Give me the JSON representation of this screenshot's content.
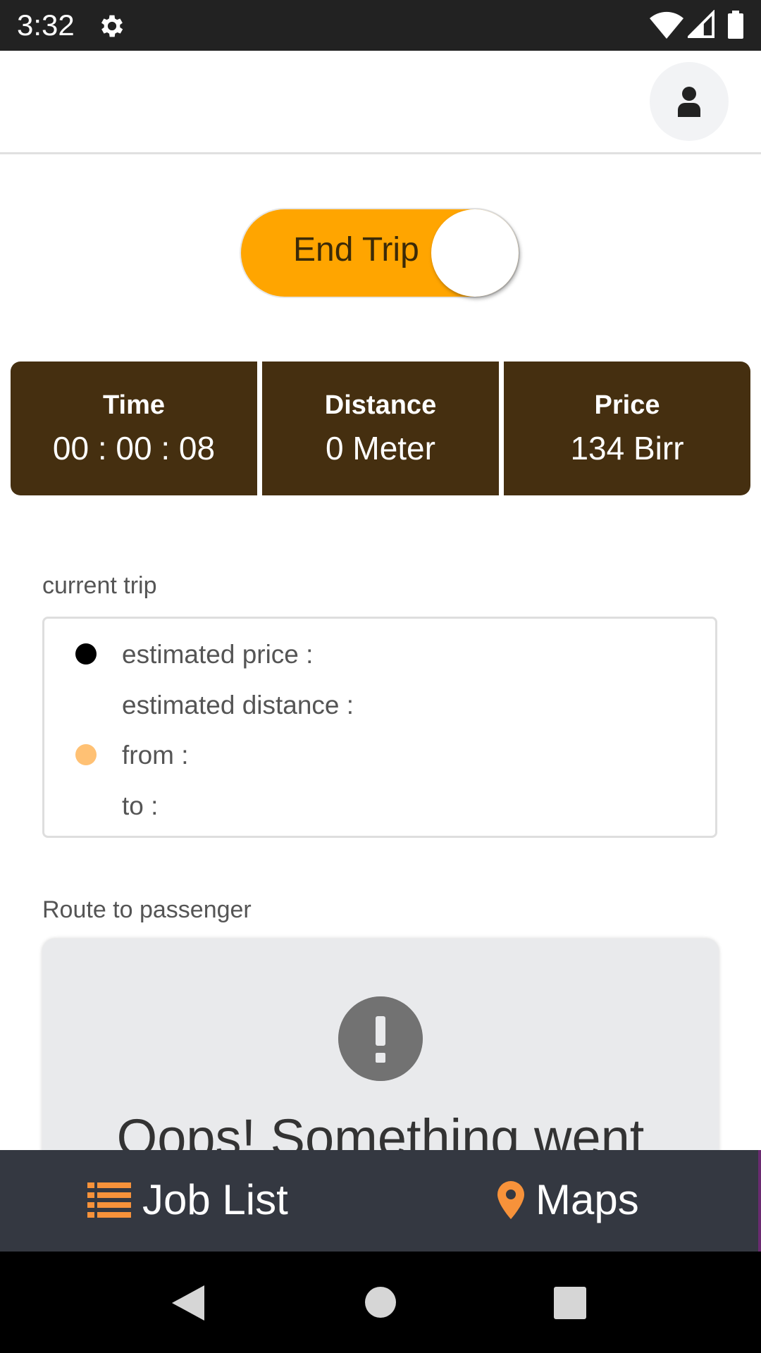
{
  "status_bar": {
    "time": "3:32",
    "icons": [
      "gear-icon",
      "wifi-icon",
      "signal-icon",
      "battery-icon"
    ]
  },
  "header": {
    "profile_icon": "person-icon"
  },
  "trip_toggle": {
    "label": "End Trip",
    "color": "#FFA500"
  },
  "stats": [
    {
      "title": "Time",
      "value": "00 : 00 : 08"
    },
    {
      "title": "Distance",
      "value": "0 Meter"
    },
    {
      "title": "Price",
      "value": "134 Birr"
    }
  ],
  "current_trip": {
    "section_label": "current trip",
    "rows": [
      {
        "label": "estimated price :"
      },
      {
        "label": "estimated distance :"
      },
      {
        "label": "from :"
      },
      {
        "label": "to :"
      }
    ],
    "marker_colors": {
      "origin": "#000000",
      "destination": "#FFC174"
    }
  },
  "route": {
    "section_label": "Route to passenger",
    "error_icon": "exclamation-icon",
    "error_text": "Oops! Something went"
  },
  "bottom_nav": {
    "items": [
      {
        "label": "Job List",
        "icon": "list-icon"
      },
      {
        "label": "Maps",
        "icon": "map-pin-icon"
      }
    ],
    "accent": "#F7923A"
  },
  "system_nav": {
    "icons": [
      "back-icon",
      "home-icon",
      "recents-icon"
    ]
  }
}
